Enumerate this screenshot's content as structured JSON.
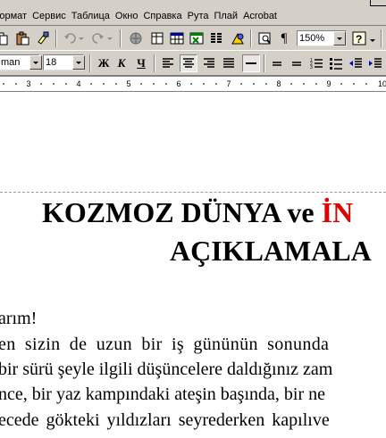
{
  "menu": {
    "items": [
      "Формат",
      "Сервис",
      "Таблица",
      "Окно",
      "Справка",
      "Рута",
      "Плай",
      "Acrobat"
    ]
  },
  "toolbar": {
    "zoom_value": "150%",
    "font_name": "man",
    "font_size": "18",
    "bold_label": "Ж",
    "italic_label": "К",
    "underline_label": "Ч"
  },
  "ruler": {
    "numbers": [
      "3",
      "4",
      "5",
      "6",
      "7",
      "8",
      "9",
      "10"
    ]
  },
  "document": {
    "title_line1": "KOZMOZ DÜNYA ve ",
    "title_line1_red": "İN",
    "title_line2": "AÇIKLAMALA",
    "lines": [
      "arım!",
      "en sizin de uzun bir iş gününün sonunda",
      "bir sürü şeyle ilgili düşüncelere daldığınız zam",
      "nce, bir yaz kampındaki ateşin başında, bir ne",
      "ecede gökteki yıldızları seyrederken kapılıve"
    ]
  },
  "colors": {
    "chrome": "#d4d0c8",
    "accent_red": "#e00000"
  }
}
